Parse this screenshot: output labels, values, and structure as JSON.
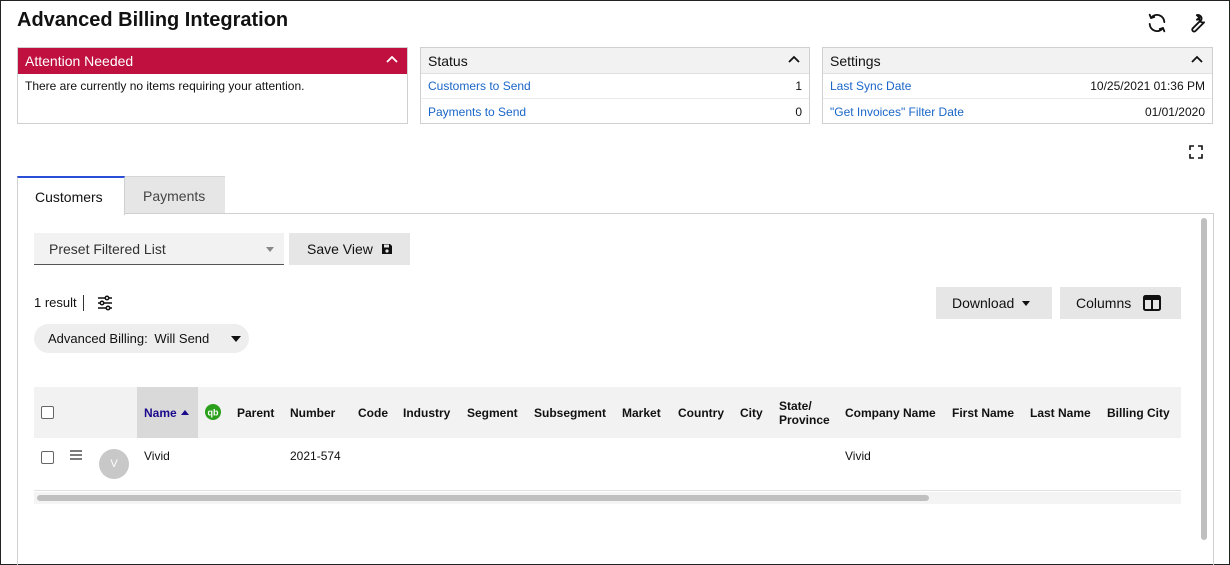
{
  "page": {
    "title": "Advanced Billing Integration"
  },
  "header_icons": [
    "refresh-icon",
    "wrench-icon"
  ],
  "attention": {
    "title": "Attention Needed",
    "message": "There are currently no items requiring your attention.",
    "accent": "#c0103f"
  },
  "status": {
    "title": "Status",
    "rows": [
      {
        "label": "Customers to Send",
        "value": "1"
      },
      {
        "label": "Payments to Send",
        "value": "0"
      }
    ]
  },
  "settings": {
    "title": "Settings",
    "rows": [
      {
        "label": "Last Sync Date",
        "value": "10/25/2021 01:36 PM"
      },
      {
        "label": "\"Get Invoices\" Filter Date",
        "value": "01/01/2020"
      }
    ]
  },
  "tabs": [
    {
      "label": "Customers",
      "active": true
    },
    {
      "label": "Payments",
      "active": false
    }
  ],
  "toolbar": {
    "preset_value": "Preset Filtered List",
    "save_view_label": "Save View",
    "download_label": "Download",
    "columns_label": "Columns"
  },
  "results": {
    "count_text": "1 result",
    "filter_chip_key": "Advanced Billing:",
    "filter_chip_value": "Will Send"
  },
  "table": {
    "columns": [
      "Name",
      "Parent",
      "Number",
      "Code",
      "Industry",
      "Segment",
      "Subsegment",
      "Market",
      "Country",
      "City",
      "State/ Province",
      "Company Name",
      "First Name",
      "Last Name",
      "Billing City"
    ],
    "sorted_column": "Name",
    "rows": [
      {
        "avatar": "V",
        "name": "Vivid",
        "parent": "",
        "number": "2021-574",
        "company_name": "Vivid"
      }
    ]
  },
  "colors": {
    "link": "#1a66c8",
    "tab_active_border": "#2a4fd6",
    "quickbooks_green": "#2ca01c"
  }
}
